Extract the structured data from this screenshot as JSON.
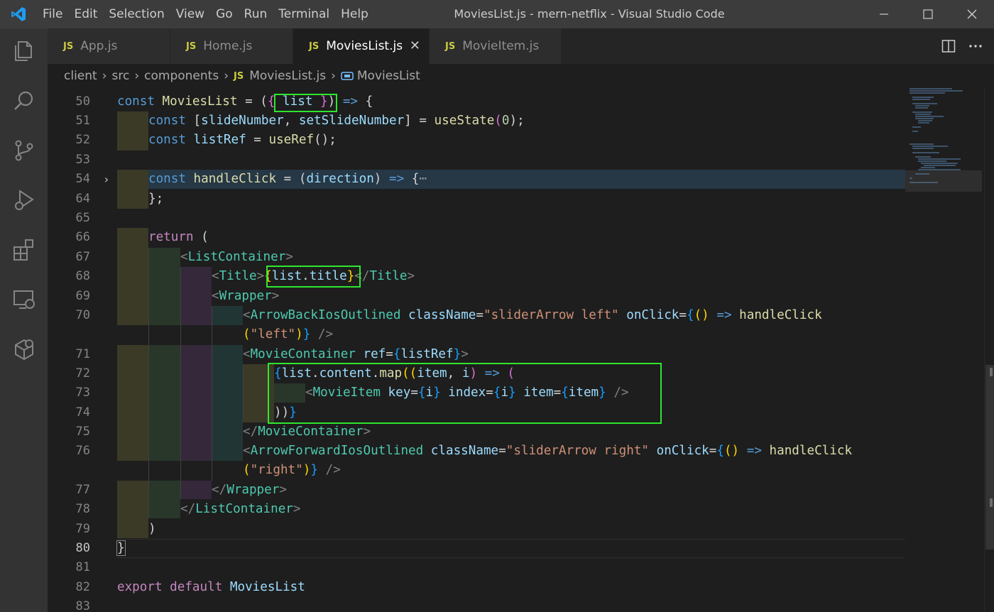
{
  "window": {
    "title": "MoviesList.js - mern-netflix - Visual Studio Code",
    "menu": [
      "File",
      "Edit",
      "Selection",
      "View",
      "Go",
      "Run",
      "Terminal",
      "Help"
    ]
  },
  "activity_bar": {
    "icons": [
      "explorer-icon",
      "search-icon",
      "source-control-icon",
      "run-debug-icon",
      "extensions-icon",
      "remote-explorer-icon",
      "docker-icon"
    ]
  },
  "tabs": [
    {
      "badge": "JS",
      "label": "App.js",
      "active": false
    },
    {
      "badge": "JS",
      "label": "Home.js",
      "active": false
    },
    {
      "badge": "JS",
      "label": "MoviesList.js",
      "active": true,
      "close": "✕"
    },
    {
      "badge": "JS",
      "label": "MovieItem.js",
      "active": false
    }
  ],
  "breadcrumb": {
    "items": [
      "client",
      "src",
      "components"
    ],
    "file_badge": "JS",
    "file": "MoviesList.js",
    "symbol": "MoviesList"
  },
  "editor": {
    "line_numbers": [
      "50",
      "51",
      "52",
      "53",
      "54",
      "64",
      "65",
      "66",
      "67",
      "68",
      "69",
      "70",
      "",
      "71",
      "72",
      "73",
      "74",
      "75",
      "76",
      "",
      "77",
      "78",
      "79",
      "80",
      "81",
      "82",
      "83"
    ],
    "current_line": "80",
    "code": {
      "l50": {
        "a": "const",
        "b": " MoviesList",
        "c": " = (",
        "d": "{",
        "e": " list ",
        "f": "}",
        "g": ") ",
        "h": "=>",
        "i": " {"
      },
      "l51": {
        "a": "const",
        "b": " [",
        "c": "slideNumber",
        "d": ", ",
        "e": "setSlideNumber",
        "f": "] = ",
        "g": "useState",
        "h": "(",
        "i": "0",
        "j": ");"
      },
      "l52": {
        "a": "const",
        "b": " listRef",
        "c": " = ",
        "d": "useRef",
        "e": "();"
      },
      "l54": {
        "a": "const",
        "b": " handleClick",
        "c": " = (",
        "d": "direction",
        "e": ") ",
        "f": "=>",
        "g": " {",
        "h": "⋯"
      },
      "l64": {
        "a": "};"
      },
      "l66": {
        "a": "return",
        "b": " ("
      },
      "l67": {
        "a": "<",
        "b": "ListContainer",
        "c": ">"
      },
      "l68": {
        "a": "<",
        "b": "Title",
        "c": ">",
        "d": "{",
        "e": "list",
        "f": ".",
        "g": "title",
        "h": "}",
        "i": "</",
        "j": "Title",
        "k": ">"
      },
      "l69": {
        "a": "<",
        "b": "Wrapper",
        "c": ">"
      },
      "l70": {
        "a": "<",
        "b": "ArrowBackIosOutlined",
        "c": " className",
        "d": "=",
        "e": "\"sliderArrow left\"",
        "f": " onClick",
        "g": "=",
        "h": "{",
        "i": "()",
        "j": " => ",
        "k": "handleClick"
      },
      "l70b": {
        "a": "(",
        "b": "\"left\"",
        "c": ")",
        "d": "}",
        "e": " />"
      },
      "l71": {
        "a": "<",
        "b": "MovieContainer",
        "c": " ref",
        "d": "=",
        "e": "{",
        "f": "listRef",
        "g": "}",
        "h": ">"
      },
      "l72": {
        "a": "{",
        "b": "list",
        "c": ".",
        "d": "content",
        "e": ".",
        "f": "map",
        "g": "((",
        "h": "item",
        "i": ", ",
        "j": "i",
        "k": ") ",
        "l": "=>",
        "m": " ("
      },
      "l73": {
        "a": "<",
        "b": "MovieItem",
        "c": " key",
        "d": "=",
        "e": "{",
        "f": "i",
        "g": "}",
        "h": " index",
        "i": "=",
        "j": "{",
        "k": "i",
        "l": "}",
        "m": " item",
        "n": "=",
        "o": "{",
        "p": "item",
        "q": "}",
        "r": " />"
      },
      "l74": {
        "a": "))",
        "b": "}"
      },
      "l75": {
        "a": "</",
        "b": "MovieContainer",
        "c": ">"
      },
      "l76": {
        "a": "<",
        "b": "ArrowForwardIosOutlined",
        "c": " className",
        "d": "=",
        "e": "\"sliderArrow right\"",
        "f": " onClick",
        "g": "=",
        "h": "{",
        "i": "()",
        "j": " => ",
        "k": "handleClick"
      },
      "l76b": {
        "a": "(",
        "b": "\"right\"",
        "c": ")",
        "d": "}",
        "e": " />"
      },
      "l77": {
        "a": "</",
        "b": "Wrapper",
        "c": ">"
      },
      "l78": {
        "a": "</",
        "b": "ListContainer",
        "c": ">"
      },
      "l79": {
        "a": ")"
      },
      "l80": {
        "a": "}"
      },
      "l82": {
        "a": "export",
        "b": " default",
        "c": " MoviesList"
      }
    }
  },
  "colors": {
    "highlight_box": "#2ee62e",
    "accent": "#007acc"
  }
}
